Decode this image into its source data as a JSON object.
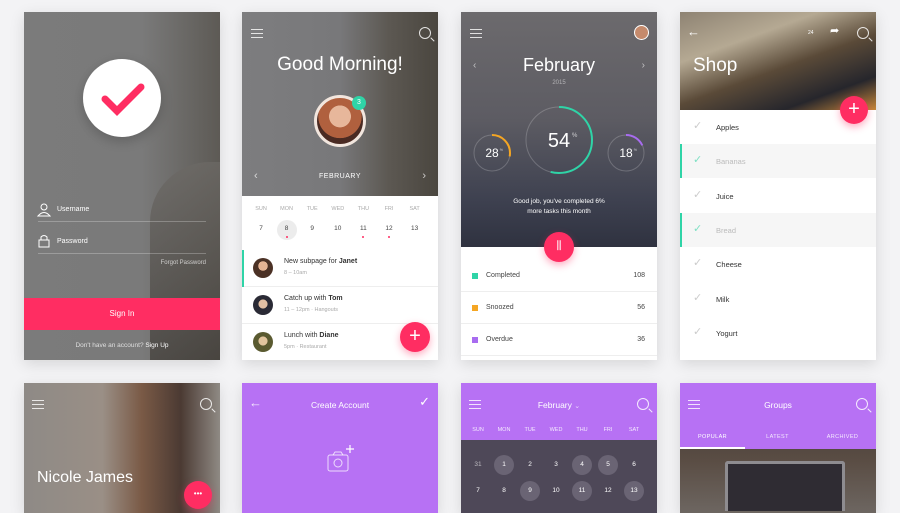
{
  "login": {
    "username_label": "Username",
    "password_label": "Password",
    "forgot_label": "Forgot Password",
    "signin_label": "Sign In",
    "footer_text": "Don't have an account?",
    "signup_label": "Sign Up",
    "accent": "#ff2d62"
  },
  "schedule": {
    "greeting": "Good Morning!",
    "badge": "3",
    "month": "FEBRUARY",
    "weekdays": [
      "SUN",
      "MON",
      "TUE",
      "WED",
      "THU",
      "FRI",
      "SAT"
    ],
    "dates": [
      "7",
      "8",
      "9",
      "10",
      "11",
      "12",
      "13"
    ],
    "events": [
      {
        "title": "New subpage for",
        "name": "Janet",
        "sub": "8 – 10am",
        "active": true
      },
      {
        "title": "Catch up with",
        "name": "Tom",
        "sub": "11 – 12pm · Hangouts"
      },
      {
        "title": "Lunch with",
        "name": "Diane",
        "sub": "5pm · Restaurant"
      }
    ],
    "fab_label": "+"
  },
  "stats": {
    "month": "February",
    "year": "2015",
    "rings": [
      {
        "value": 54,
        "color": "#2fd4a7",
        "unit": "%"
      },
      {
        "value": 28,
        "color": "#f5a623",
        "unit": "%"
      },
      {
        "value": 18,
        "color": "#a86cf0",
        "unit": "%"
      }
    ],
    "message_line1": "Good job, you've completed 6%",
    "message_line2": "more tasks this month",
    "items": [
      {
        "label": "Completed",
        "count": "108",
        "color": "#2fd4a7"
      },
      {
        "label": "Snoozed",
        "count": "56",
        "color": "#f5a623"
      },
      {
        "label": "Overdue",
        "count": "36",
        "color": "#a86cf0"
      }
    ]
  },
  "shop": {
    "title": "Shop",
    "cart_count": "24",
    "fab_label": "+",
    "items": [
      {
        "label": "Apples",
        "done": false
      },
      {
        "label": "Bananas",
        "done": true
      },
      {
        "label": "Juice",
        "done": false
      },
      {
        "label": "Bread",
        "done": true
      },
      {
        "label": "Cheese",
        "done": false
      },
      {
        "label": "Milk",
        "done": false
      },
      {
        "label": "Yogurt",
        "done": false
      }
    ]
  },
  "profile": {
    "name": "Nicole James"
  },
  "create_account": {
    "title": "Create Account"
  },
  "calendar": {
    "month": "February",
    "weekdays": [
      "SUN",
      "MON",
      "TUE",
      "WED",
      "THU",
      "FRI",
      "SAT"
    ],
    "week1": [
      "31",
      "1",
      "2",
      "3",
      "4",
      "5",
      "6"
    ],
    "week2": [
      "7",
      "8",
      "9",
      "10",
      "11",
      "12",
      "13"
    ]
  },
  "groups": {
    "title": "Groups",
    "tabs": [
      "POPULAR",
      "LATEST",
      "ARCHIVED"
    ],
    "active_tab": "POPULAR"
  },
  "colors": {
    "pink": "#ff2d62",
    "teal": "#2fd4a7",
    "purple": "#b771f4"
  }
}
